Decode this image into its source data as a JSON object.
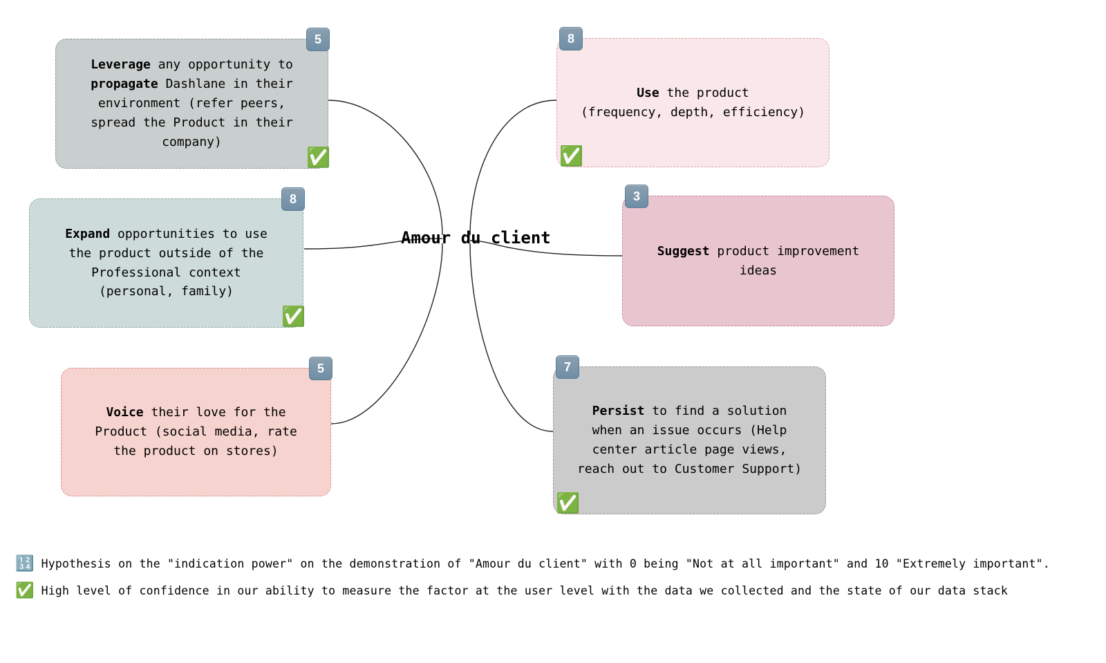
{
  "center_label": "Amour du client",
  "cards": {
    "leverage": {
      "score": "5",
      "check": true,
      "html": "<b>Leverage</b> any opportunity to <b>propagate</b> Dashlane in their environment (refer peers, spread the Product in their company)"
    },
    "expand": {
      "score": "8",
      "check": true,
      "html": "<b>Expand</b> opportunities to use the product outside of the Professional context (personal, family)"
    },
    "voice": {
      "score": "5",
      "check": false,
      "html": "<b>Voice</b> their love for the Product (social media, rate the product on stores)"
    },
    "use": {
      "score": "8",
      "check": true,
      "html": "<b>Use</b> the product<br>(frequency, depth, efficiency)"
    },
    "suggest": {
      "score": "3",
      "check": false,
      "html": "<b>Suggest</b> product improvement ideas"
    },
    "persist": {
      "score": "7",
      "check": true,
      "html": "<b>Persist</b> to find a solution when an issue occurs (Help center article page views, reach out to Customer Support)"
    }
  },
  "legend": {
    "numeric_icon": "🔢",
    "check_icon": "✅",
    "line1": "Hypothesis on the \"indication power\" on the demonstration of \"Amour du client\"  with 0 being \"Not at all important\" and 10 \"Extremely important\".",
    "line2": "High level of confidence in our ability to measure the factor at the user level with the data we collected and the state of our data stack"
  },
  "colors": {
    "leverage_bg": "#c9cfce",
    "leverage_bd": "#8f9998",
    "expand_bg": "#cddbdb",
    "expand_bd": "#8ea9a6",
    "voice_bg": "#f6d3ce",
    "voice_bd": "#d8938b",
    "use_bg": "#fae7e9",
    "use_bd": "#dca1aa",
    "suggest_bg": "#e9c6cf",
    "suggest_bd": "#c4859a",
    "persist_bg": "#cacbca",
    "persist_bd": "#9a9b9a"
  }
}
